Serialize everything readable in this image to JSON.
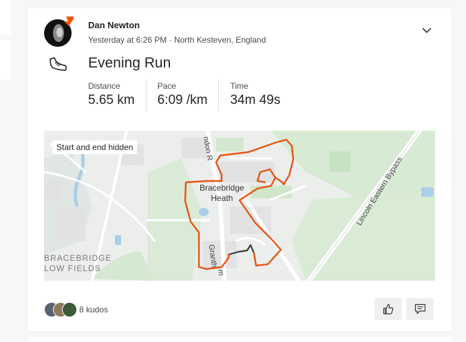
{
  "athlete": {
    "name": "Dan Newton",
    "timestamp": "Yesterday at 6:26 PM · North Kesteven, England"
  },
  "activity": {
    "title": "Evening Run",
    "sport_icon": "running-shoe-icon"
  },
  "stats": [
    {
      "label": "Distance",
      "value": "5.65 km"
    },
    {
      "label": "Pace",
      "value": "6:09 /km"
    },
    {
      "label": "Time",
      "value": "34m 49s"
    }
  ],
  "map": {
    "privacy_tag": "Start and end hidden",
    "place_label_line1": "Bracebridge",
    "place_label_line2": "Heath",
    "area_label_line1": "BRACEBRIDGE",
    "area_label_line2": "LOW FIELDS",
    "road_label_1": "Lincoln Eastern Bypass",
    "road_label_2": "ndon R",
    "road_label_3": "Granth",
    "road_label_3b": "m",
    "route_color": "#e5550f",
    "hidden_segment_color": "#3a3a3a"
  },
  "kudos": {
    "count_label": "8 kudos"
  },
  "actions": {
    "kudos_icon": "thumbs-up-icon",
    "comment_icon": "comment-icon"
  },
  "colors": {
    "brand": "#fc5200",
    "text": "#242428",
    "muted": "#494950"
  }
}
